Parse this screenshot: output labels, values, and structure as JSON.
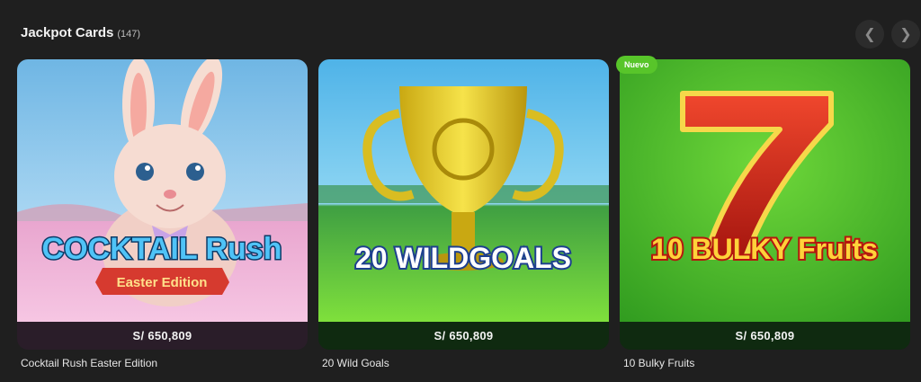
{
  "section": {
    "title": "Jackpot Cards",
    "count": "(147)"
  },
  "nav": {
    "prev_icon": "chevron-left-icon",
    "next_icon": "chevron-right-icon"
  },
  "cards": [
    {
      "name": "Cocktail Rush Easter Edition",
      "jackpot": "S/ 650,809",
      "logo_main": "COCKTAIL Rush",
      "logo_sub": "Easter Edition"
    },
    {
      "name": "20 Wild Goals",
      "jackpot": "S/ 650,809",
      "logo_main": "20 WILDGOALS"
    },
    {
      "name": "10 Bulky Fruits",
      "jackpot": "S/ 650,809",
      "logo_main": "10 BULKY Fruits",
      "badge": "Nuevo"
    }
  ]
}
